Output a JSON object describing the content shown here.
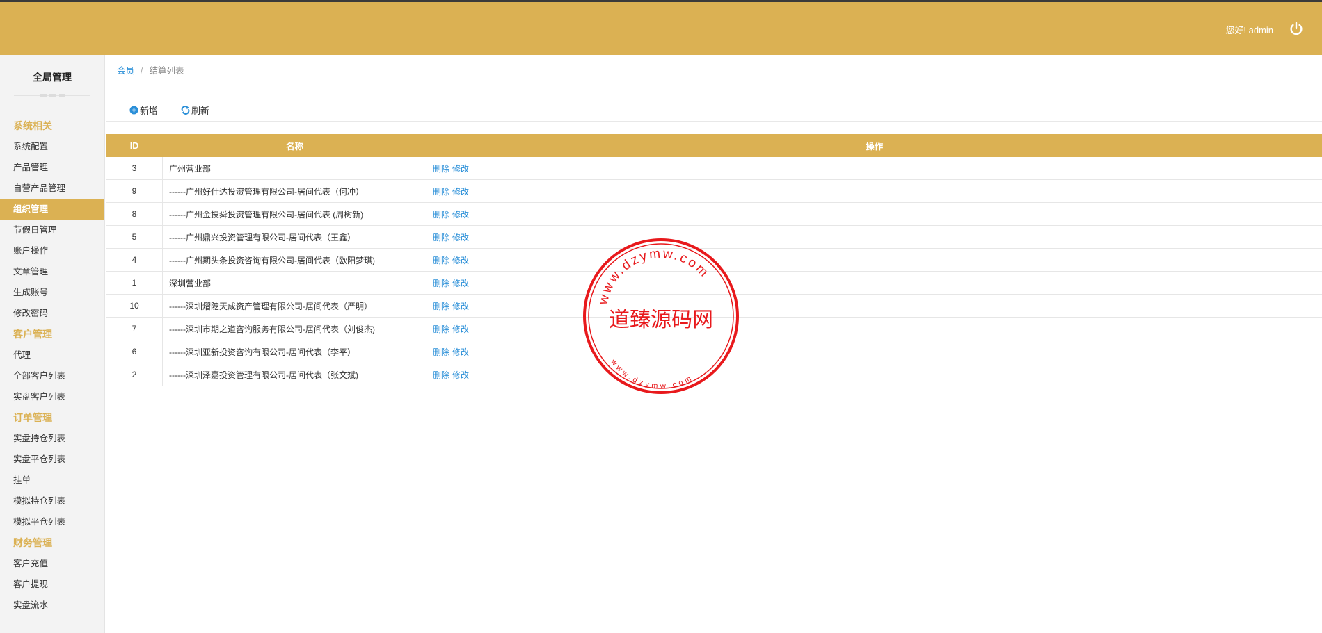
{
  "header": {
    "greeting": "您好! admin",
    "logout_icon": "power-icon"
  },
  "sidebar": {
    "title": "全局管理",
    "groups": [
      {
        "label": "系统相关",
        "items": [
          "系统配置",
          "产品管理",
          "自营产品管理",
          "组织管理",
          "节假日管理",
          "账户操作",
          "文章管理",
          "生成账号",
          "修改密码"
        ]
      },
      {
        "label": "客户管理",
        "items": [
          "代理",
          "全部客户列表",
          "实盘客户列表"
        ]
      },
      {
        "label": "订单管理",
        "items": [
          "实盘持仓列表",
          "实盘平仓列表",
          "挂单",
          "模拟持仓列表",
          "模拟平仓列表"
        ]
      },
      {
        "label": "财务管理",
        "items": [
          "客户充值",
          "客户提现",
          "实盘流水"
        ]
      }
    ],
    "active_item": "组织管理"
  },
  "breadcrumb": {
    "parent": "会员",
    "sep": "/",
    "current": "结算列表"
  },
  "toolbar": {
    "add_label": "新增",
    "refresh_label": "刷新"
  },
  "table": {
    "headers": {
      "id": "ID",
      "name": "名称",
      "op": "操作"
    },
    "rows": [
      {
        "id": "3",
        "name": "广州营业部"
      },
      {
        "id": "9",
        "name": "------广州好仕达投资管理有限公司-居间代表（何冲）"
      },
      {
        "id": "8",
        "name": "------广州金投舜投资管理有限公司-居间代表 (周树新)"
      },
      {
        "id": "5",
        "name": "------广州鼎兴投资管理有限公司-居间代表（王鑫）"
      },
      {
        "id": "4",
        "name": "------广州期头条投资咨询有限公司-居间代表（欧阳梦琪)"
      },
      {
        "id": "1",
        "name": "深圳营业部"
      },
      {
        "id": "10",
        "name": "------深圳熠阸天成资产管理有限公司-居间代表（严明）"
      },
      {
        "id": "7",
        "name": "------深圳市期之道咨询服务有限公司-居间代表（刘俊杰)"
      },
      {
        "id": "6",
        "name": "------深圳亚新投资咨询有限公司-居间代表（李平）"
      },
      {
        "id": "2",
        "name": "------深圳泽嘉投资管理有限公司-居间代表（张文斌)"
      }
    ],
    "actions": {
      "delete": "删除",
      "edit": "修改"
    }
  },
  "watermark": {
    "center": "道臻源码网",
    "outer_ring": "www.dzymw.com",
    "inner_ring": "www.dzymw.com",
    "color": "#e8191c"
  },
  "colors": {
    "accent": "#dbb153",
    "link": "#2a8fd8"
  }
}
